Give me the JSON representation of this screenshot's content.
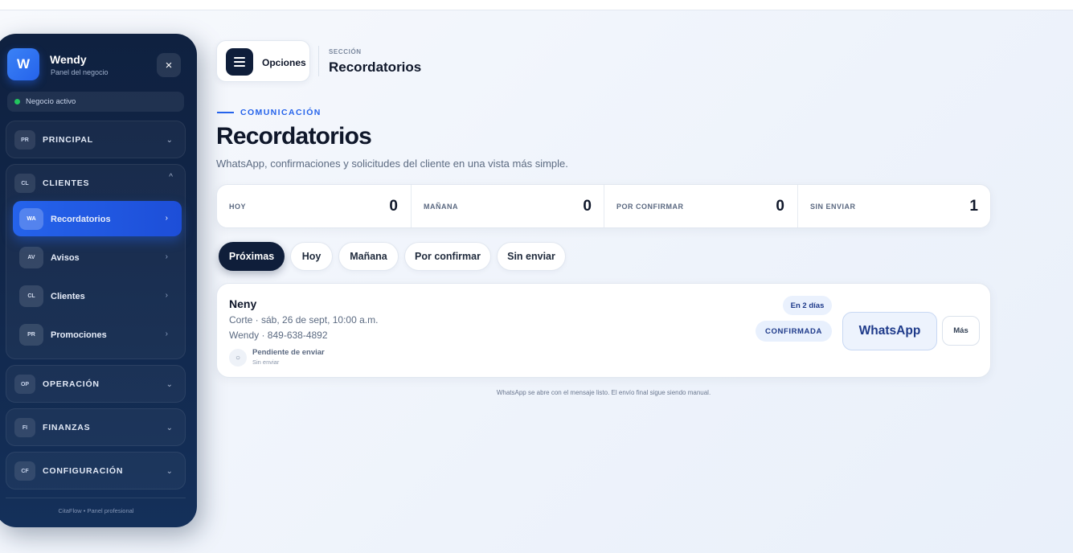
{
  "sidebar": {
    "brand": {
      "initial": "W",
      "name": "Wendy",
      "subtitle": "Panel del negocio",
      "close_icon": "×"
    },
    "status": "Negocio activo",
    "groups": [
      {
        "code": "PR",
        "label": "PRINCIPAL",
        "chevron": "⌄"
      },
      {
        "code": "CL",
        "label": "CLIENTES",
        "chevron": "^"
      },
      {
        "code": "OP",
        "label": "OPERACIÓN",
        "chevron": "⌄"
      },
      {
        "code": "FI",
        "label": "FINANZAS",
        "chevron": "⌄"
      },
      {
        "code": "CF",
        "label": "CONFIGURACIÓN",
        "chevron": "⌄"
      }
    ],
    "items": [
      {
        "code": "WA",
        "label": "Recordatorios",
        "chevron": "›",
        "active": true
      },
      {
        "code": "AV",
        "label": "Avisos",
        "chevron": "›"
      },
      {
        "code": "CL",
        "label": "Clientes",
        "chevron": "›"
      },
      {
        "code": "PR",
        "label": "Promociones",
        "chevron": "›"
      }
    ],
    "footer": "CitaFlow  •  Panel profesional"
  },
  "header": {
    "menu_label": "Opciones",
    "section_kicker": "SECCIÓN",
    "section_title": "Recordatorios"
  },
  "page": {
    "kicker": "COMUNICACIÓN",
    "title": "Recordatorios",
    "subtitle": "WhatsApp, confirmaciones y solicitudes del cliente en una vista más simple."
  },
  "stats": [
    {
      "label": "HOY",
      "value": "0"
    },
    {
      "label": "MAÑANA",
      "value": "0"
    },
    {
      "label": "POR CONFIRMAR",
      "value": "0"
    },
    {
      "label": "SIN ENVIAR",
      "value": "1"
    }
  ],
  "tabs": [
    {
      "label": "Próximas",
      "active": true
    },
    {
      "label": "Hoy"
    },
    {
      "label": "Mañana"
    },
    {
      "label": "Por confirmar"
    },
    {
      "label": "Sin enviar"
    }
  ],
  "reminder": {
    "name": "Neny",
    "service": "Corte · sáb, 26 de sept, 10:00 a.m.",
    "contact": "Wendy · 849-638-4892",
    "status_icon": "○",
    "send_status": "Pendiente de enviar",
    "send_substatus": "Sin enviar",
    "days_badge": "En 2 días",
    "confirmation": "CONFIRMADA",
    "whatsapp_label": "WhatsApp",
    "more_label": "Más"
  },
  "footnote": "WhatsApp se abre con el mensaje listo. El envío final sigue siendo manual.",
  "colors": {
    "accent": "#2563eb",
    "sidebar": "#112649",
    "status_active": "#22c55e"
  }
}
